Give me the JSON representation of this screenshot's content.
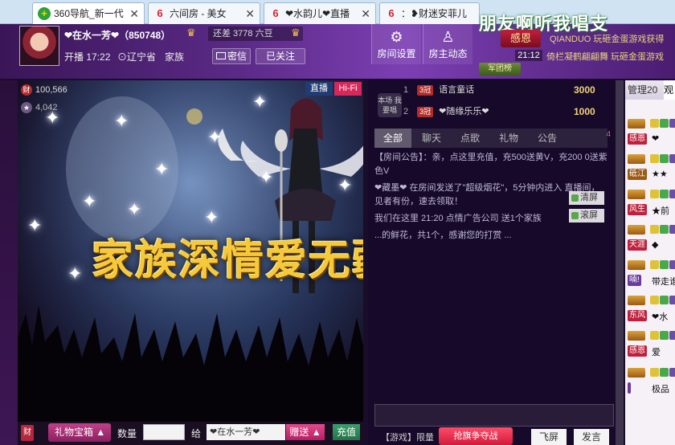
{
  "tabs": [
    {
      "label": "360导航_新一代",
      "favicon": "360"
    },
    {
      "label": "六间房 - 美女",
      "favicon": "6"
    },
    {
      "label": "❤水韵儿❤直播",
      "favicon": "6"
    },
    {
      "label": "：❥财迷安菲儿",
      "favicon": "6"
    }
  ],
  "header": {
    "anchor_name": "❤在水一芳❤（850748）",
    "gap_text": "还差 3778 六豆",
    "live_time": "开播 17:22",
    "location": "辽宁省",
    "family_label": "家族",
    "whisper_label": "密信",
    "followed_label": "已关注",
    "room_settings": "房间设置",
    "host_news": "房主动态",
    "banner": "朋友啊听我唱支",
    "ganen": "感恩",
    "news1": "QIANDUO 玩砸金蛋游戏获得",
    "news_time": "21:12",
    "news2": "倚栏凝鹤翩翩舞 玩砸金蛋游戏",
    "army": "军团榜"
  },
  "video": {
    "stat_fans": "100,566",
    "stat_other": "4,042",
    "tag_live": "直播",
    "tag_hifi": "Hi-Fi",
    "slogan": "家族深情爱无疆"
  },
  "queue": [
    {
      "rank": "1",
      "level": "3冠",
      "name": "语言童话",
      "gold": "3000"
    },
    {
      "rank": "2",
      "level": "3冠",
      "name": "❤随缘乐乐❤",
      "gold": "1000"
    }
  ],
  "sing_label": "本场 我要唱",
  "chat_tabs": [
    "全部",
    "聊天",
    "点歌",
    "礼物",
    "公告"
  ],
  "chat_tab_count": "4",
  "chat_lines": [
    "【房间公告】：亲，点这里充值，充500送黄V，充200 0送紫色V",
    "❤藏墨❤ 在房间发送了\"超级烟花\"，5分钟内进入 直播间，见者有份，速去领取！",
    "我们在这里 21:20 点情广告公司 送1个家族",
    "",
    "...的鲜花，共1个，感谢您的打赏 ..."
  ],
  "clear_btn": "清屏",
  "scroll_btn": "滚屏",
  "game_limit": "【游戏】限量",
  "flag_btn": "抢旗争夺战",
  "fly_btn": "飞屏",
  "send_btn": "发言",
  "right": {
    "tab_admin": "管理20",
    "tab_audience": "观",
    "users": [
      {
        "nick": "感恩",
        "sym": "❤",
        "color": "#c0203c"
      },
      {
        "nick": "砥江",
        "sym": "★★",
        "color": "#9c5a12"
      },
      {
        "nick": "风生",
        "sym": "★前",
        "color": "#c0203c"
      },
      {
        "nick": "天涯",
        "sym": "◆",
        "color": "#c0203c"
      },
      {
        "nick": "喃!",
        "sym": "带走谁",
        "color": "#6b3a9b"
      },
      {
        "nick": "东风",
        "sym": "❤水",
        "color": "#c0203c"
      },
      {
        "nick": "感恩",
        "sym": "爱",
        "color": "#c0203c"
      },
      {
        "nick": "",
        "sym": "极品",
        "color": "#6b3a9b"
      }
    ]
  },
  "bottom": {
    "red": "财",
    "gift_box": "礼物宝箱",
    "qty_label": "数量",
    "give_label": "给",
    "recipient": "❤在水一芳❤",
    "give_btn": "赠送",
    "charge_btn": "充值"
  }
}
